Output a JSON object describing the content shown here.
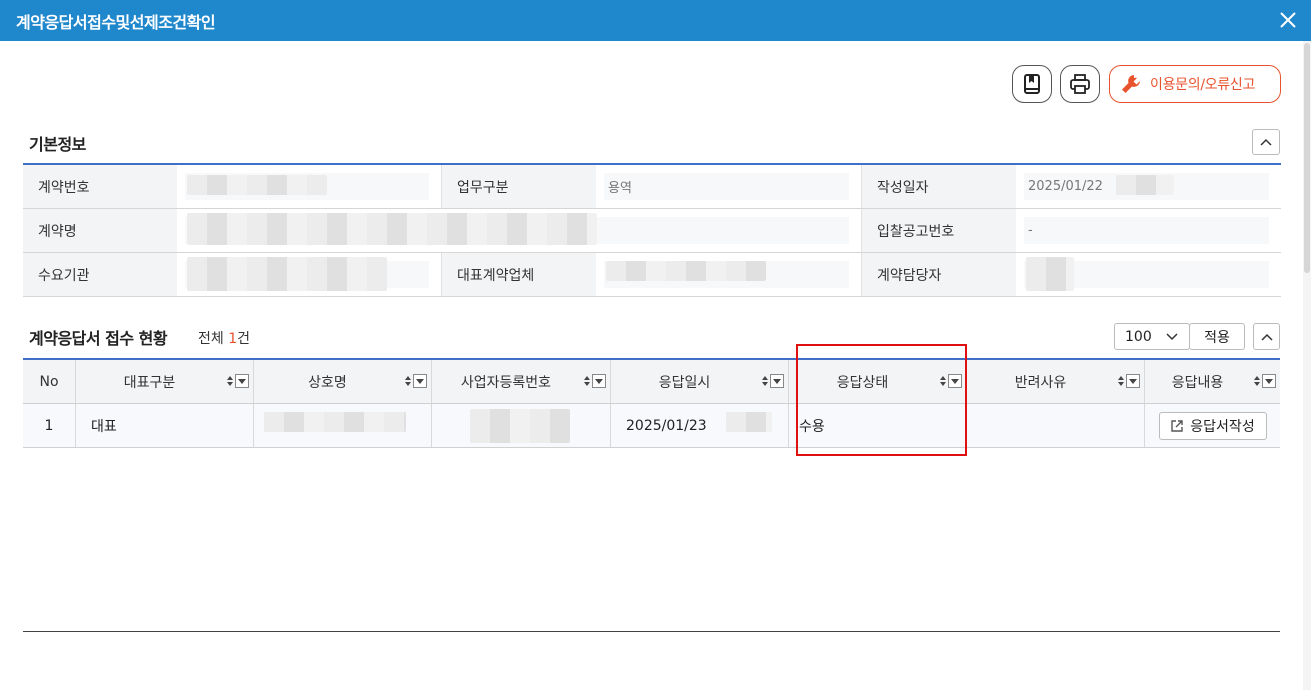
{
  "dialog": {
    "title": "계약응답서접수및선제조건확인"
  },
  "toolbar": {
    "report_label": "이용문의/오류신고"
  },
  "basic_info": {
    "title": "기본정보",
    "rows": [
      [
        {
          "label": "계약번호",
          "value": ""
        },
        {
          "label": "업무구분",
          "value": "용역"
        },
        {
          "label": "작성일자",
          "value": "2025/01/22"
        }
      ],
      [
        {
          "label": "계약명",
          "value": ""
        },
        {
          "label": "입찰공고번호",
          "value": "-"
        }
      ],
      [
        {
          "label": "수요기관",
          "value": ""
        },
        {
          "label": "대표계약업체",
          "value": ""
        },
        {
          "label": "계약담당자",
          "value": ""
        }
      ]
    ]
  },
  "receipt_status": {
    "title": "계약응답서 접수 현황",
    "count_prefix": "전체 ",
    "count": "1",
    "count_suffix": "건",
    "page_size": "100",
    "apply_label": "적용",
    "columns": [
      "No",
      "대표구분",
      "상호명",
      "사업자등록번호",
      "응답일시",
      "응답상태",
      "반려사유",
      "응답내용"
    ],
    "rows": [
      {
        "no": "1",
        "type": "대표",
        "company": "",
        "biz_no": "",
        "date": "2025/01/23",
        "status": "수용",
        "reason": "",
        "action": "응답서작성"
      }
    ]
  },
  "colors": {
    "title_bar": "#1f87cc",
    "accent": "#e8532e",
    "table_border": "#3f6fc7",
    "highlight": "#e01010"
  }
}
